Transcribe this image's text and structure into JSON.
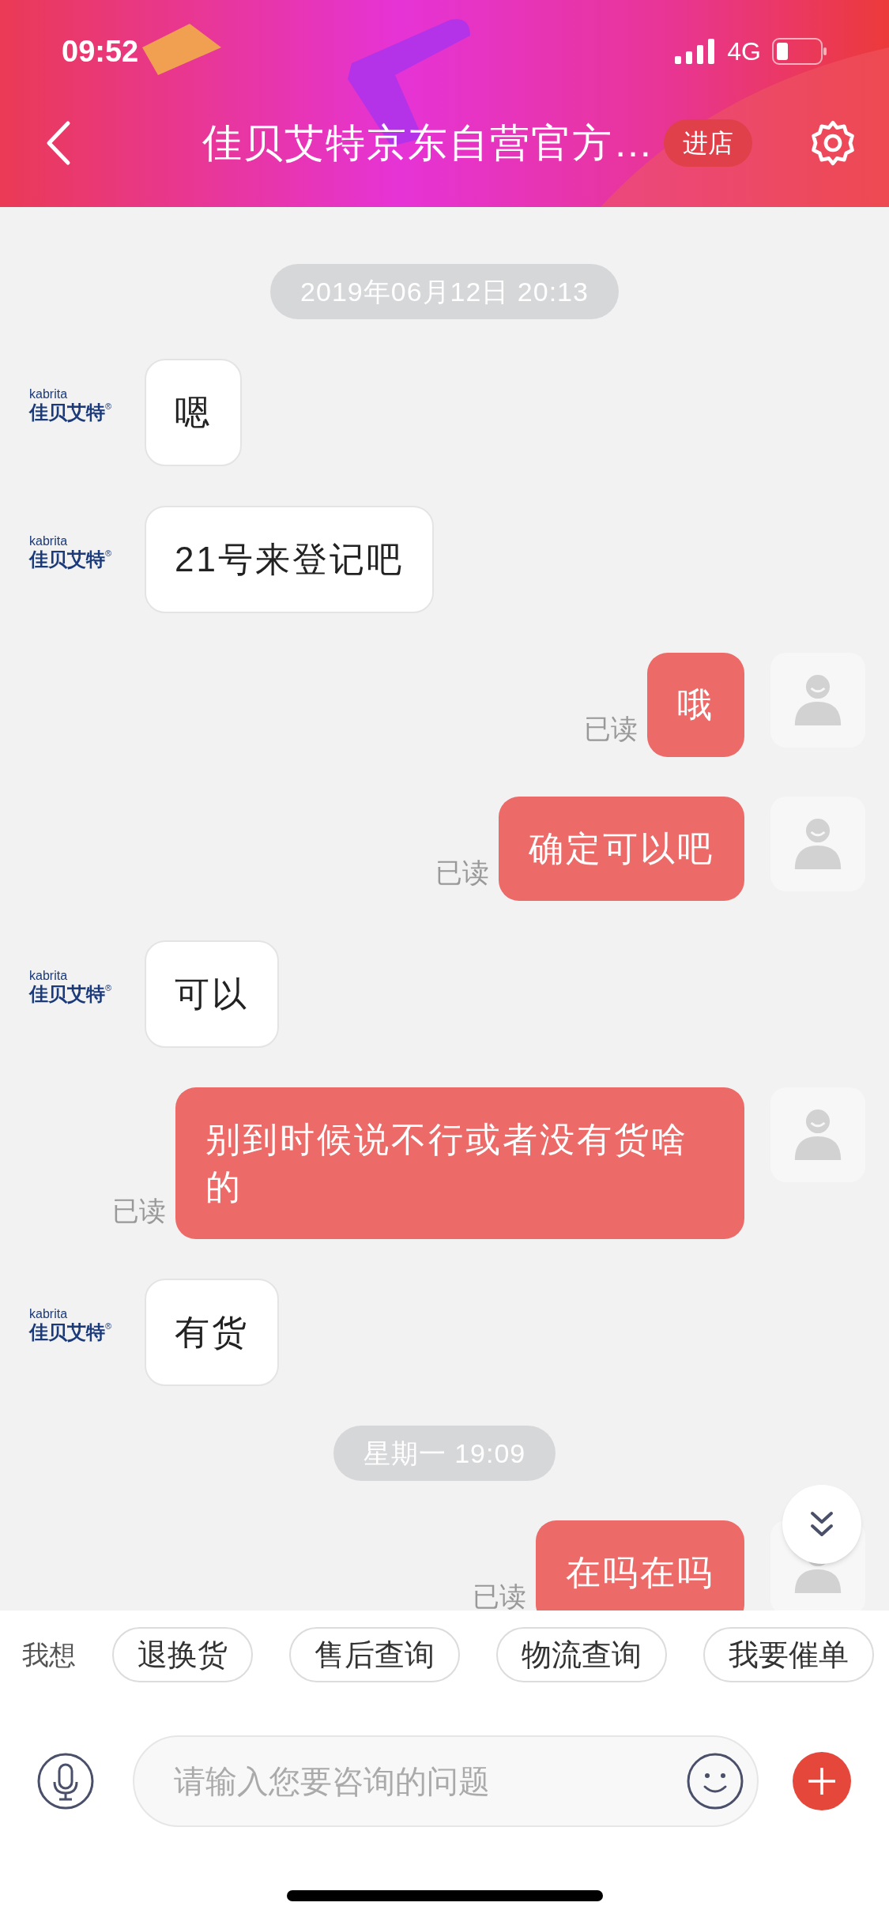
{
  "status_bar": {
    "time": "09:52",
    "network": "4G"
  },
  "header": {
    "title": "佳贝艾特京东自营官方…",
    "store_button": "进店"
  },
  "messages": [
    {
      "kind": "timestamp",
      "text": "2019年06月12日 20:13"
    },
    {
      "kind": "incoming",
      "text": "嗯",
      "sender": {
        "brand": "kabrita",
        "name": "佳贝艾特",
        "mark": "®"
      }
    },
    {
      "kind": "incoming",
      "text": "21号来登记吧",
      "sender": {
        "brand": "kabrita",
        "name": "佳贝艾特",
        "mark": "®"
      }
    },
    {
      "kind": "outgoing",
      "text": "哦",
      "receipt": "已读"
    },
    {
      "kind": "outgoing",
      "text": "确定可以吧",
      "receipt": "已读"
    },
    {
      "kind": "incoming",
      "text": "可以",
      "sender": {
        "brand": "kabrita",
        "name": "佳贝艾特",
        "mark": "®"
      }
    },
    {
      "kind": "outgoing",
      "text": "别到时候说不行或者没有货啥的",
      "receipt": "已读"
    },
    {
      "kind": "incoming",
      "text": "有货",
      "sender": {
        "brand": "kabrita",
        "name": "佳贝艾特",
        "mark": "®"
      }
    },
    {
      "kind": "timestamp",
      "text": "星期一 19:09"
    },
    {
      "kind": "outgoing",
      "text": "在吗在吗",
      "receipt": "已读"
    }
  ],
  "quick_actions": {
    "label": "我想",
    "chips": [
      "退换货",
      "售后查询",
      "物流查询",
      "我要催单"
    ]
  },
  "composer": {
    "placeholder": "请输入您要咨询的问题"
  }
}
